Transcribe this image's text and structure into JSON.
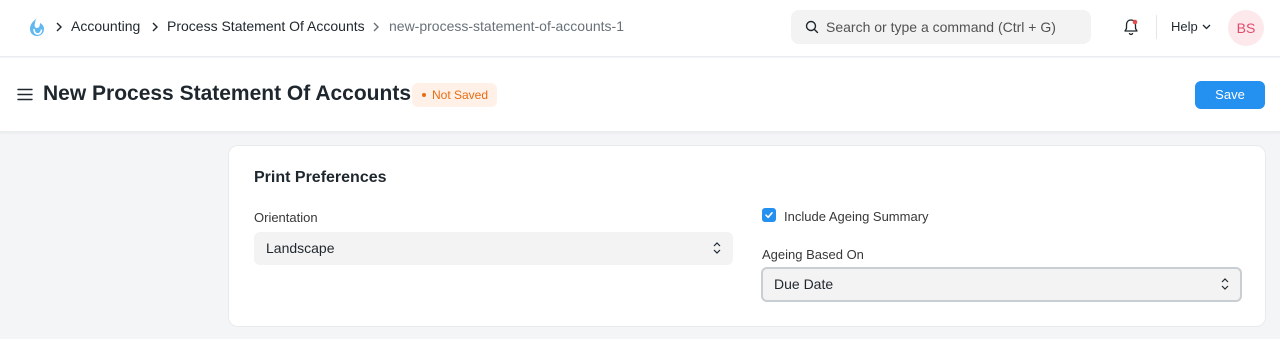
{
  "navbar": {
    "logo_icon": "frappe-logo-icon",
    "breadcrumbs": [
      "Accounting",
      "Process Statement Of Accounts",
      "new-process-statement-of-accounts-1"
    ],
    "search_placeholder": "Search or type a command (Ctrl + G)",
    "help_label": "Help",
    "avatar_initials": "BS"
  },
  "page": {
    "title": "New Process Statement Of Accounts",
    "status": "Not Saved",
    "save_label": "Save"
  },
  "section": {
    "title": "Print Preferences",
    "orientation_label": "Orientation",
    "orientation_value": "Landscape",
    "include_ageing_label": "Include Ageing Summary",
    "include_ageing_checked": true,
    "ageing_based_on_label": "Ageing Based On",
    "ageing_based_on_value": "Due Date"
  },
  "colors": {
    "primary": "#2490ef",
    "status_text": "#e86c13",
    "status_bg": "#fff1e7",
    "avatar_bg": "#fde8ec",
    "avatar_text": "#e24c6c"
  }
}
